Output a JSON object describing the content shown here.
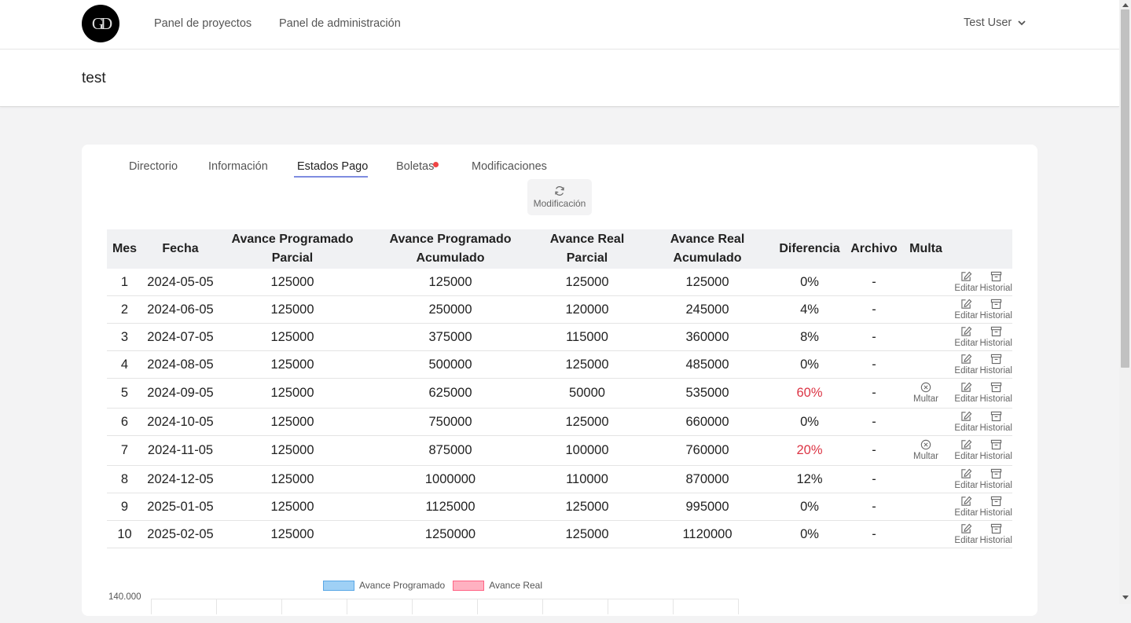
{
  "header": {
    "logo_text": "GD",
    "nav": [
      "Panel de proyectos",
      "Panel de administración"
    ],
    "user": "Test User"
  },
  "page": {
    "title": "test"
  },
  "tabs": [
    {
      "label": "Directorio",
      "active": false
    },
    {
      "label": "Información",
      "active": false
    },
    {
      "label": "Estados Pago",
      "active": true
    },
    {
      "label": "Boletas",
      "active": false,
      "badge_color": "#ef4444"
    },
    {
      "label": "Modificaciones",
      "active": false
    }
  ],
  "modificacion_button": "Modificación",
  "table": {
    "headers": [
      "Mes",
      "Fecha",
      "Avance Programado Parcial",
      "Avance Programado Acumulado",
      "Avance Real Parcial",
      "Avance Real Acumulado",
      "Diferencia",
      "Archivo",
      "Multa"
    ],
    "action_labels": {
      "multar": "Multar",
      "editar": "Editar",
      "historial": "Historial"
    },
    "rows": [
      {
        "mes": "1",
        "fecha": "2024-05-05",
        "app": "125000",
        "apa": "125000",
        "arp": "125000",
        "ara": "125000",
        "dif": "0%",
        "archivo": "-",
        "dif_alert": false,
        "multar": false
      },
      {
        "mes": "2",
        "fecha": "2024-06-05",
        "app": "125000",
        "apa": "250000",
        "arp": "120000",
        "ara": "245000",
        "dif": "4%",
        "archivo": "-",
        "dif_alert": false,
        "multar": false
      },
      {
        "mes": "3",
        "fecha": "2024-07-05",
        "app": "125000",
        "apa": "375000",
        "arp": "115000",
        "ara": "360000",
        "dif": "8%",
        "archivo": "-",
        "dif_alert": false,
        "multar": false
      },
      {
        "mes": "4",
        "fecha": "2024-08-05",
        "app": "125000",
        "apa": "500000",
        "arp": "125000",
        "ara": "485000",
        "dif": "0%",
        "archivo": "-",
        "dif_alert": false,
        "multar": false
      },
      {
        "mes": "5",
        "fecha": "2024-09-05",
        "app": "125000",
        "apa": "625000",
        "arp": "50000",
        "ara": "535000",
        "dif": "60%",
        "archivo": "-",
        "dif_alert": true,
        "multar": true
      },
      {
        "mes": "6",
        "fecha": "2024-10-05",
        "app": "125000",
        "apa": "750000",
        "arp": "125000",
        "ara": "660000",
        "dif": "0%",
        "archivo": "-",
        "dif_alert": false,
        "multar": false
      },
      {
        "mes": "7",
        "fecha": "2024-11-05",
        "app": "125000",
        "apa": "875000",
        "arp": "100000",
        "ara": "760000",
        "dif": "20%",
        "archivo": "-",
        "dif_alert": true,
        "multar": true
      },
      {
        "mes": "8",
        "fecha": "2024-12-05",
        "app": "125000",
        "apa": "1000000",
        "arp": "110000",
        "ara": "870000",
        "dif": "12%",
        "archivo": "-",
        "dif_alert": false,
        "multar": false
      },
      {
        "mes": "9",
        "fecha": "2025-01-05",
        "app": "125000",
        "apa": "1125000",
        "arp": "125000",
        "ara": "995000",
        "dif": "0%",
        "archivo": "-",
        "dif_alert": false,
        "multar": false
      },
      {
        "mes": "10",
        "fecha": "2025-02-05",
        "app": "125000",
        "apa": "1250000",
        "arp": "125000",
        "ara": "1120000",
        "dif": "0%",
        "archivo": "-",
        "dif_alert": false,
        "multar": false
      }
    ]
  },
  "chart": {
    "legend": [
      {
        "label": "Avance Programado",
        "fill": "#9fd0f5",
        "stroke": "#5aa7e6"
      },
      {
        "label": "Avance Real",
        "fill": "#ffb1c1",
        "stroke": "#ff6384"
      }
    ],
    "y_top_tick": "140.000"
  }
}
